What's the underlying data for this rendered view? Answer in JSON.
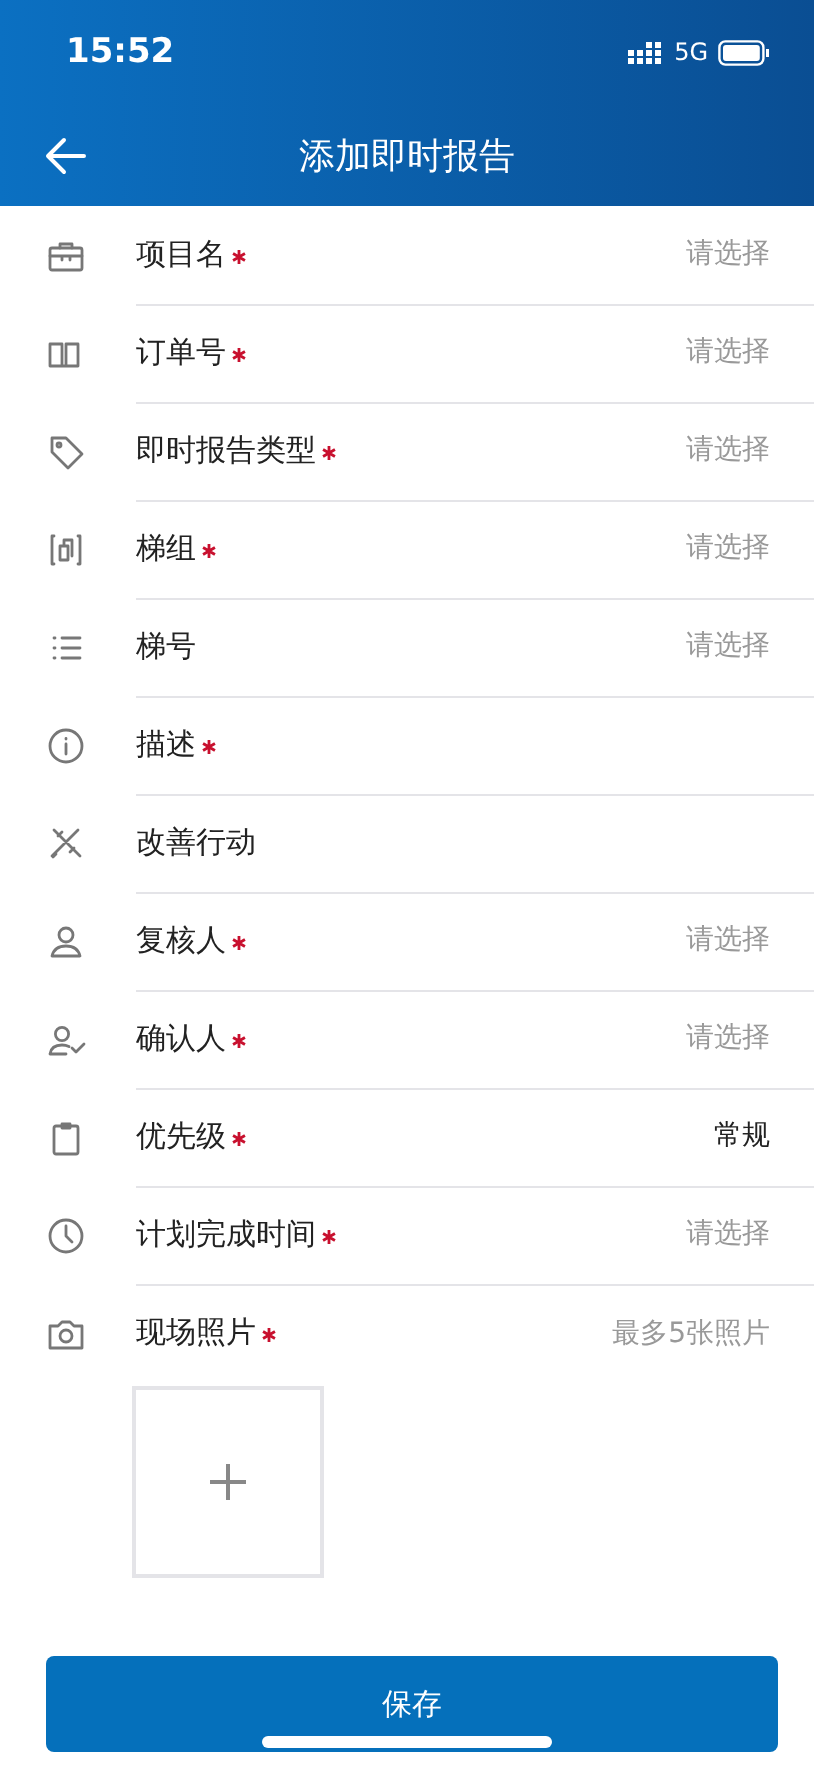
{
  "status_bar": {
    "time": "15:52",
    "network": "5G"
  },
  "header": {
    "title": "添加即时报告"
  },
  "fields": [
    {
      "label": "项目名",
      "required": true,
      "placeholder": "请选择"
    },
    {
      "label": "订单号",
      "required": true,
      "placeholder": "请选择"
    },
    {
      "label": "即时报告类型",
      "required": true,
      "placeholder": "请选择"
    },
    {
      "label": "梯组",
      "required": true,
      "placeholder": "请选择"
    },
    {
      "label": "梯号",
      "required": false,
      "placeholder": "请选择"
    },
    {
      "label": "描述",
      "required": true
    },
    {
      "label": "改善行动",
      "required": false
    },
    {
      "label": "复核人",
      "required": true,
      "placeholder": "请选择"
    },
    {
      "label": "确认人",
      "required": true,
      "placeholder": "请选择"
    },
    {
      "label": "优先级",
      "required": true,
      "value": "常规"
    },
    {
      "label": "计划完成时间",
      "required": true,
      "placeholder": "请选择"
    },
    {
      "label": "现场照片",
      "required": true,
      "placeholder": "最多5张照片"
    }
  ],
  "save_button": "保存"
}
